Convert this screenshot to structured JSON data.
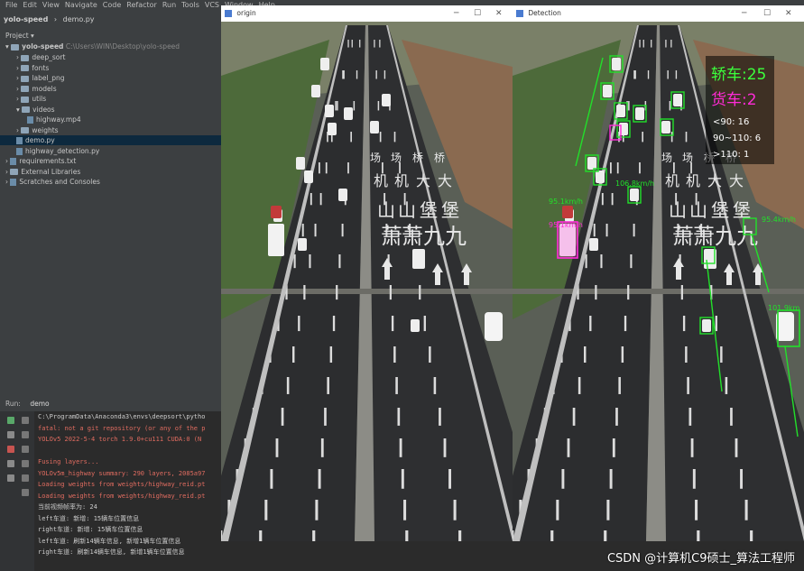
{
  "menu": [
    "File",
    "Edit",
    "View",
    "Navigate",
    "Code",
    "Refactor",
    "Run",
    "Tools",
    "VCS",
    "Window",
    "Help"
  ],
  "navbar": {
    "project": "yolo-speed",
    "file": "demo.py"
  },
  "project_panel": {
    "header": "Project",
    "root": "yolo-speed",
    "root_path": "C:\\Users\\WIN\\Desktop\\yolo-speed",
    "items": [
      "deep_sort",
      "fonts",
      "label_png",
      "models",
      "utils",
      "videos",
      "highway.mp4",
      "weights",
      "demo.py",
      "highway_detection.py",
      "requirements.txt",
      "External Libraries",
      "Scratches and Consoles"
    ]
  },
  "run": {
    "tab_run": "Run:",
    "tab_demo": "demo",
    "lines": [
      {
        "text": "C:\\ProgramData\\Anaconda3\\envs\\deepsort\\pytho",
        "color": "white"
      },
      {
        "text": "fatal: not a git repository (or any of the p",
        "color": "red"
      },
      {
        "text": "YOLOv5  2022-5-4 torch 1.9.0+cu111 CUDA:0 (N",
        "color": "red"
      },
      {
        "text": "",
        "color": "white"
      },
      {
        "text": "Fusing layers...",
        "color": "red"
      },
      {
        "text": "YOLOv5m_highway summary: 290 layers, 2085a97",
        "color": "red"
      },
      {
        "text": "Loading weights from weights/highway_reid.pt",
        "color": "red"
      },
      {
        "text": "Loading weights from weights/highway_reid.pt",
        "color": "red"
      },
      {
        "text": "当前视频帧率为: 24",
        "color": "white"
      },
      {
        "text": "left车道: 新增: 15辆车位置信息",
        "color": "white"
      },
      {
        "text": "right车道: 新增: 15辆车位置信息",
        "color": "white"
      },
      {
        "text": "left车道: 刷新14辆车信息, 新增1辆车位置信息",
        "color": "white"
      },
      {
        "text": "right车道: 刷新14辆车信息, 新增1辆车位置信息",
        "color": "white"
      }
    ]
  },
  "origin_window": {
    "title": "origin"
  },
  "detection_window": {
    "title": "Detection"
  },
  "road_text": [
    "场",
    "场",
    "桥",
    "桥",
    "机",
    "机",
    "大",
    "大",
    "山",
    "山",
    "堡",
    "堡",
    "萧",
    "萧",
    "九",
    "九"
  ],
  "hud": {
    "car_label": "轿车:25",
    "truck_label": "货车:2",
    "speed_bins": [
      "<90: 16",
      "90~110: 6",
      ">110: 1"
    ]
  },
  "speed_labels": [
    "95.1km/h",
    "95.4km/h",
    "101.9km",
    "106.8km/h",
    "95.1km/h"
  ],
  "watermark": "CSDN @计算机C9硕士_算法工程师",
  "colors": {
    "car_box": "#22e02a",
    "truck_box": "#ff2bd8",
    "hud_text": "#3cff3c"
  }
}
